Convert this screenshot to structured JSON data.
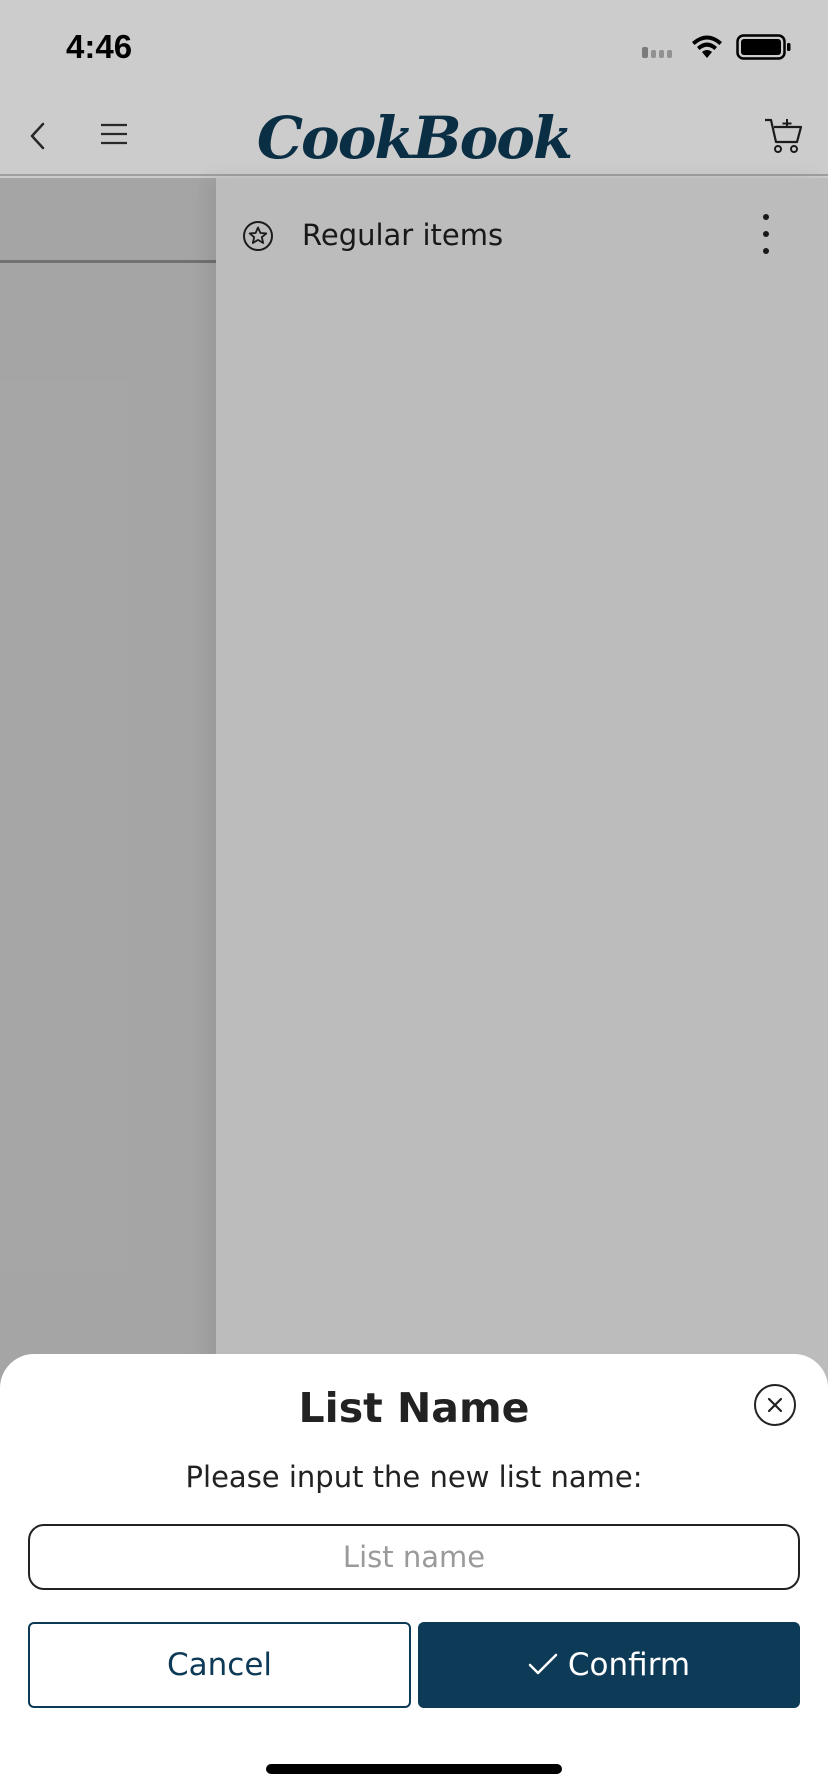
{
  "status_bar": {
    "time": "4:46"
  },
  "header": {
    "logo_text": "CookBook"
  },
  "list": {
    "items": [
      {
        "label": "Regular items",
        "icon": "star-circle-icon"
      }
    ]
  },
  "dialog": {
    "title": "List Name",
    "message": "Please input the new list name:",
    "input_value": "",
    "input_placeholder": "List name",
    "cancel_label": "Cancel",
    "confirm_label": "Confirm"
  },
  "colors": {
    "brand": "#0d3a56",
    "overlay": "rgba(0,0,0,0.2)"
  }
}
